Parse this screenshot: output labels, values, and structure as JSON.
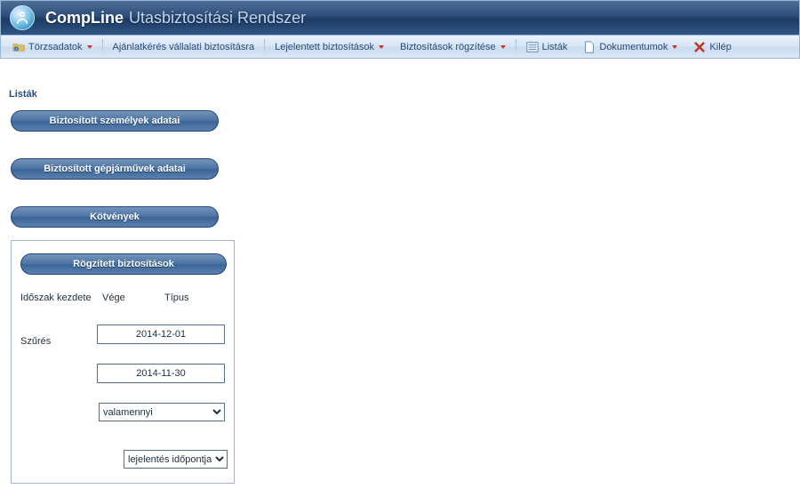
{
  "header": {
    "brand_strong": "CompLine",
    "brand_light": "Utasbiztosítási Rendszer"
  },
  "menubar": {
    "torzsadatok": "Törzsadatok",
    "ajanlatkeres": "Ajánlatkérés vállalati biztosításra",
    "lejelentett": "Lejelentett biztosítások",
    "rogzitese": "Biztosítások rögzítése",
    "listak": "Listák",
    "dokumentumok": "Dokumentumok",
    "kilep": "Kilép"
  },
  "page": {
    "heading": "Listák"
  },
  "buttons": {
    "biztositott_szemelyek": "Biztosított személyek adatai",
    "biztositott_gepjarmuvek": "Biztosított gépjárművek adatai",
    "kotvenyek": "Kötvények",
    "rogzitett_biztositasok": "Rögzített biztosítások"
  },
  "filter": {
    "h_idoszak": "Időszak kezdete",
    "h_vege": "Vége",
    "h_tipus": "Típus",
    "label_szures": "Szűrés",
    "date_start": "2014-12-01",
    "date_end": "2014-11-30",
    "select_valamennyi": "valamennyi",
    "select_lejelentes": "lejelentés időpontja"
  }
}
